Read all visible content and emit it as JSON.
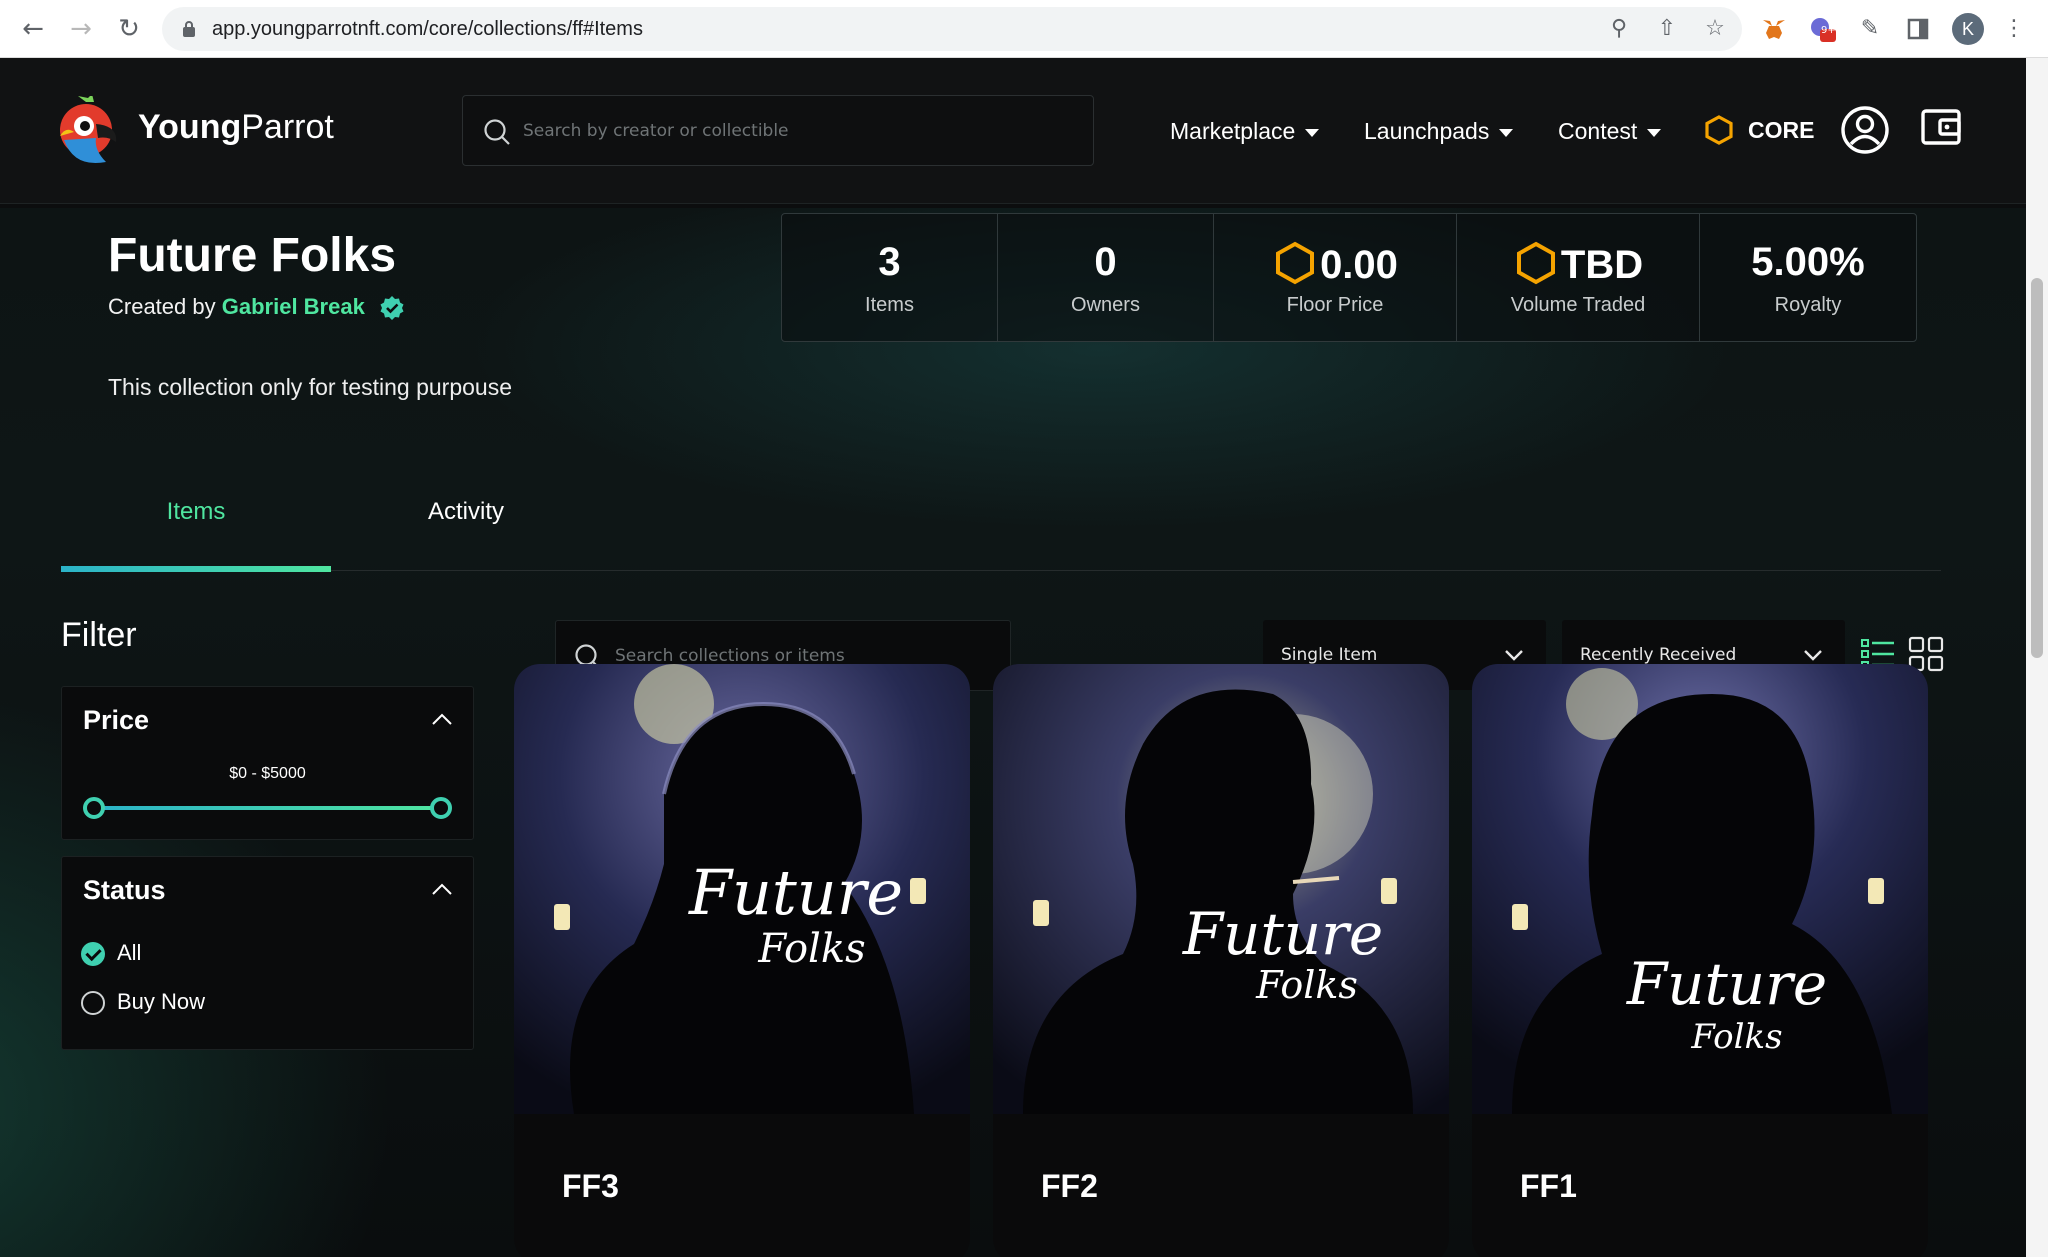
{
  "browser": {
    "url": "app.youngparrotnft.com/core/collections/ff#Items",
    "profile_initial": "K",
    "extension_badge": "9+"
  },
  "header": {
    "brand_bold": "Young",
    "brand_light": "Parrot",
    "search_placeholder": "Search by creator or collectible",
    "nav": [
      {
        "label": "Marketplace"
      },
      {
        "label": "Launchpads"
      },
      {
        "label": "Contest"
      }
    ],
    "network_label": "CORE"
  },
  "collection": {
    "title": "Future Folks",
    "created_by_prefix": "Created by",
    "creator": "Gabriel Break",
    "description": "This collection only for testing purpouse",
    "stats": [
      {
        "value": "3",
        "label": "Items",
        "currency_icon": false
      },
      {
        "value": "0",
        "label": "Owners",
        "currency_icon": false
      },
      {
        "value": "0.00",
        "label": "Floor Price",
        "currency_icon": true
      },
      {
        "value": "TBD",
        "label": "Volume Traded",
        "currency_icon": true
      },
      {
        "value": "5.00%",
        "label": "Royalty",
        "currency_icon": false
      }
    ]
  },
  "tabs": [
    {
      "label": "Items",
      "active": true
    },
    {
      "label": "Activity",
      "active": false
    }
  ],
  "filter": {
    "title": "Filter",
    "price": {
      "title": "Price",
      "range_label": "$0 - $5000",
      "min": 0,
      "max": 5000
    },
    "status": {
      "title": "Status",
      "options": [
        {
          "label": "All",
          "checked": true
        },
        {
          "label": "Buy Now",
          "checked": false
        }
      ]
    }
  },
  "toolbar": {
    "search_placeholder": "Search collections or items",
    "type_select": "Single Item",
    "sort_select": "Recently Received"
  },
  "items": [
    {
      "name": "FF3",
      "art_title_1": "Future",
      "art_title_2": "Folks"
    },
    {
      "name": "FF2",
      "art_title_1": "Future",
      "art_title_2": "Folks"
    },
    {
      "name": "FF1",
      "art_title_1": "Future",
      "art_title_2": "Folks"
    }
  ],
  "colors": {
    "accent_green": "#4fe6a0",
    "accent_teal": "#2bb3c9",
    "core_orange": "#f5a300",
    "background": "#0c0d0e"
  }
}
